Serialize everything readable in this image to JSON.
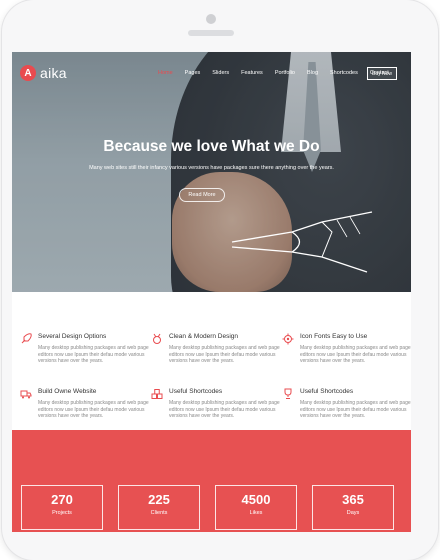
{
  "brand": {
    "logo_letter": "A",
    "name": "aika",
    "accent": "#e94b4f"
  },
  "nav": {
    "items": [
      {
        "label": "Home",
        "active": true
      },
      {
        "label": "Pages"
      },
      {
        "label": "Sliders"
      },
      {
        "label": "Features"
      },
      {
        "label": "Portfolio"
      },
      {
        "label": "Blog"
      },
      {
        "label": "Shortcodes"
      },
      {
        "label": "Contact"
      }
    ],
    "buy_label": "Buy Now"
  },
  "hero": {
    "title": "Because we love What we Do",
    "subtitle": "Many web sites still their infancy various versions have packages sure there anything over the years.",
    "button": "Read More"
  },
  "features": [
    {
      "icon": "rocket-icon",
      "title": "Several Design Options",
      "desc": "Many desktop publishing packages and web page editors now use Ipsum their defau mode various versions have over the years."
    },
    {
      "icon": "medal-icon",
      "title": "Clean & Modern Design",
      "desc": "Many desktop publishing packages and web page editors now use Ipsum their defau mode various versions have over the years."
    },
    {
      "icon": "gear-icon",
      "title": "Icon Fonts Easy to Use",
      "desc": "Many desktop publishing packages and web page editors now use Ipsum their defau mode various versions have over the years."
    },
    {
      "icon": "truck-icon",
      "title": "Build Owne Website",
      "desc": "Many desktop publishing packages and web page editors now use Ipsum their defau mode various versions have over the years."
    },
    {
      "icon": "cubes-icon",
      "title": "Useful Shortcodes",
      "desc": "Many desktop publishing packages and web page editors now use Ipsum their defau mode various versions have over the years."
    },
    {
      "icon": "trophy-icon",
      "title": "Useful Shortcodes",
      "desc": "Many desktop publishing packages and web page editors now use Ipsum their defau mode various versions have over the years."
    }
  ],
  "stats": [
    {
      "value": "270",
      "label": "Projects"
    },
    {
      "value": "225",
      "label": "Clients"
    },
    {
      "value": "4500",
      "label": "Likes"
    },
    {
      "value": "365",
      "label": "Days"
    }
  ]
}
